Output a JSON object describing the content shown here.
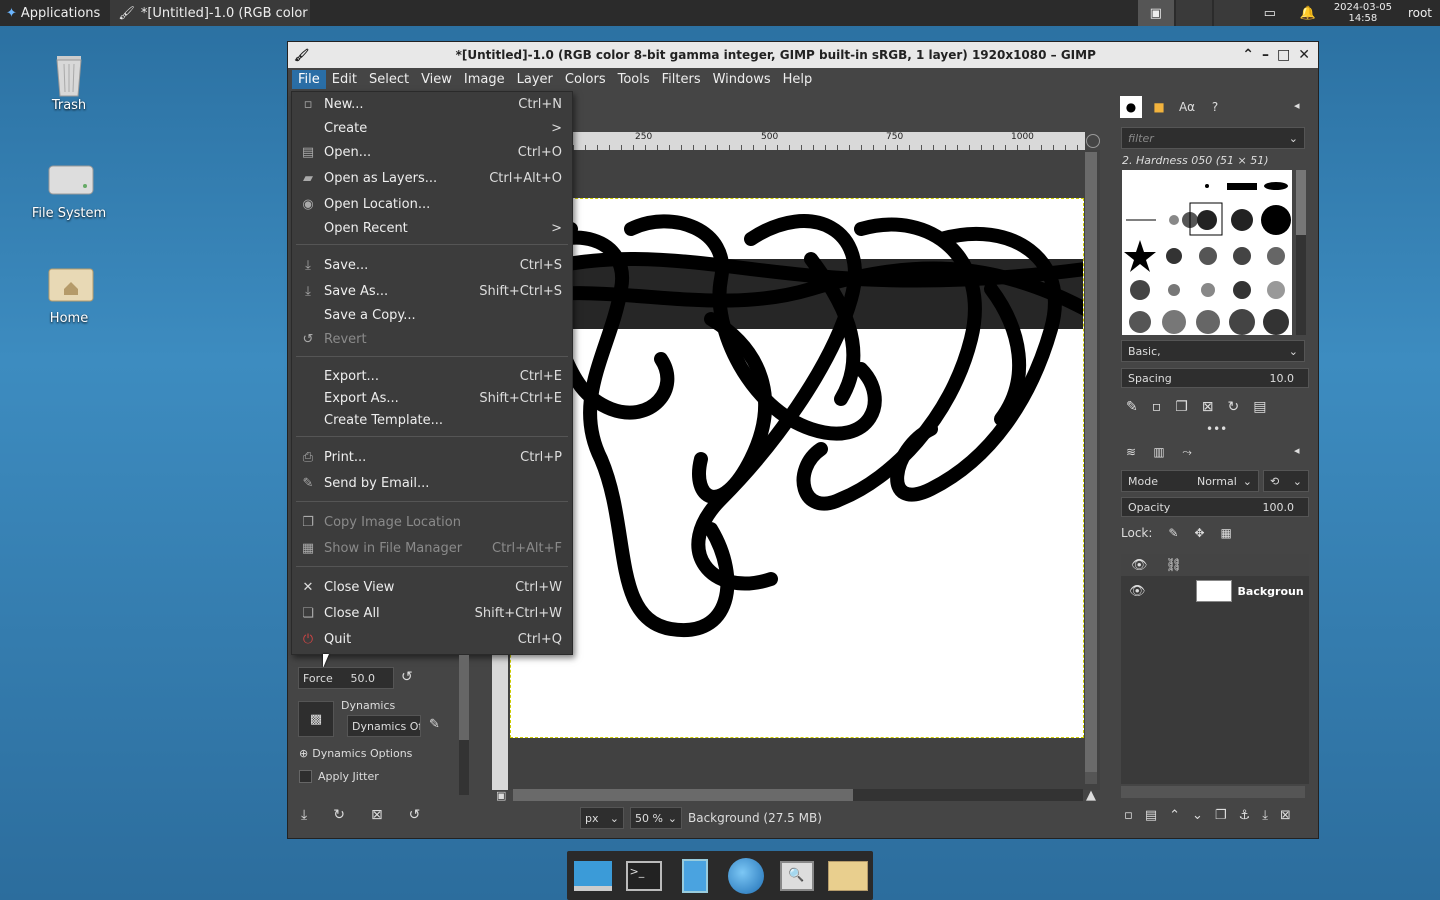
{
  "top_panel": {
    "applications_label": "Applications",
    "task_label": "*[Untitled]-1.0 (RGB color ...",
    "clock_date": "2024-03-05",
    "clock_time": "14:58",
    "user": "root"
  },
  "desktop": {
    "icons": [
      {
        "label": "Trash"
      },
      {
        "label": "File System"
      },
      {
        "label": "Home"
      }
    ]
  },
  "window": {
    "title": "*[Untitled]-1.0 (RGB color 8-bit gamma integer, GIMP built-in sRGB, 1 layer) 1920x1080 – GIMP"
  },
  "menubar": [
    "File",
    "Edit",
    "Select",
    "View",
    "Image",
    "Layer",
    "Colors",
    "Tools",
    "Filters",
    "Windows",
    "Help"
  ],
  "file_menu": {
    "items": [
      {
        "label": "New...",
        "accel": "Ctrl+N"
      },
      {
        "label": "Create",
        "accel": ">"
      },
      {
        "label": "Open...",
        "accel": "Ctrl+O"
      },
      {
        "label": "Open as Layers...",
        "accel": "Ctrl+Alt+O"
      },
      {
        "label": "Open Location...",
        "accel": ""
      },
      {
        "label": "Open Recent",
        "accel": ">"
      },
      {
        "label": "Save...",
        "accel": "Ctrl+S"
      },
      {
        "label": "Save As...",
        "accel": "Shift+Ctrl+S"
      },
      {
        "label": "Save a Copy...",
        "accel": ""
      },
      {
        "label": "Revert",
        "accel": ""
      },
      {
        "label": "Export...",
        "accel": "Ctrl+E"
      },
      {
        "label": "Export As...",
        "accel": "Shift+Ctrl+E"
      },
      {
        "label": "Create Template...",
        "accel": ""
      },
      {
        "label": "Print...",
        "accel": "Ctrl+P"
      },
      {
        "label": "Send by Email...",
        "accel": ""
      },
      {
        "label": "Copy Image Location",
        "accel": ""
      },
      {
        "label": "Show in File Manager",
        "accel": "Ctrl+Alt+F"
      },
      {
        "label": "Close View",
        "accel": "Ctrl+W"
      },
      {
        "label": "Close All",
        "accel": "Shift+Ctrl+W"
      },
      {
        "label": "Quit",
        "accel": "Ctrl+Q"
      }
    ]
  },
  "ruler": {
    "ticks": [
      "250",
      "500",
      "750",
      "1000"
    ]
  },
  "tool_options": {
    "force_label": "Force",
    "force_value": "50.0",
    "dynamics_label": "Dynamics",
    "dynamics_value": "Dynamics Of",
    "dynamics_options": "Dynamics Options",
    "apply_jitter": "Apply Jitter"
  },
  "brushes": {
    "filter_placeholder": "filter",
    "current": "2. Hardness 050 (51 × 51)",
    "tag": "Basic,",
    "spacing_label": "Spacing",
    "spacing_value": "10.0"
  },
  "layers": {
    "mode_label": "Mode",
    "mode_value": "Normal",
    "opacity_label": "Opacity",
    "opacity_value": "100.0",
    "lock_label": "Lock:",
    "layer_name": "Backgroun"
  },
  "status": {
    "unit": "px",
    "zoom": "50 %",
    "info": "Background (27.5 MB)"
  }
}
